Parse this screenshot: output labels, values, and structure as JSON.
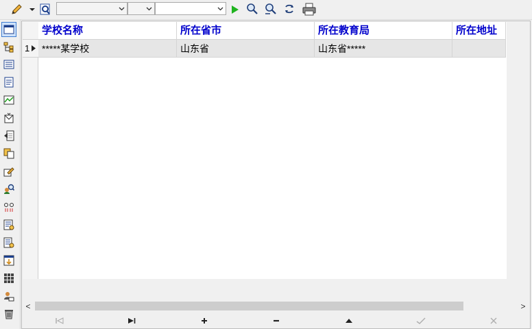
{
  "toolbar": {
    "icons": [
      "pencil-icon",
      "dropdown-arrow-icon",
      "search-doc-icon",
      "run-icon",
      "find-icon",
      "find-next-icon",
      "refresh-icon",
      "print-icon"
    ],
    "combo1_value": "",
    "combo2_value": "",
    "combo3_value": ""
  },
  "sidebar": {
    "icons": [
      "form-view-icon",
      "tree-view-icon",
      "list-view-icon",
      "document-icon",
      "chart-icon",
      "mail-icon",
      "export-icon",
      "copy-icon",
      "edit-icon",
      "user-search-icon",
      "link-icon",
      "settings-list-icon",
      "report-icon",
      "import-icon",
      "grid-icon",
      "user-settings-icon",
      "trash-icon"
    ]
  },
  "grid": {
    "columns": [
      "学校名称",
      "所在省市",
      "所在教育局",
      "所在地址"
    ],
    "rows": [
      {
        "index": "1",
        "cells": [
          "*****某学校",
          "山东省",
          "山东省*****",
          ""
        ]
      }
    ]
  },
  "scrollbar": {
    "left_arrow": "<",
    "right_arrow": ">"
  },
  "navigator": {
    "icons": [
      "first-record-icon",
      "last-record-icon",
      "insert-record-icon",
      "delete-record-icon",
      "edit-record-icon",
      "post-record-icon",
      "cancel-record-icon"
    ]
  },
  "colors": {
    "header_text": "#0000cc",
    "selected_row": "#e6e6e6",
    "active_icon": "#3d7bd0"
  }
}
